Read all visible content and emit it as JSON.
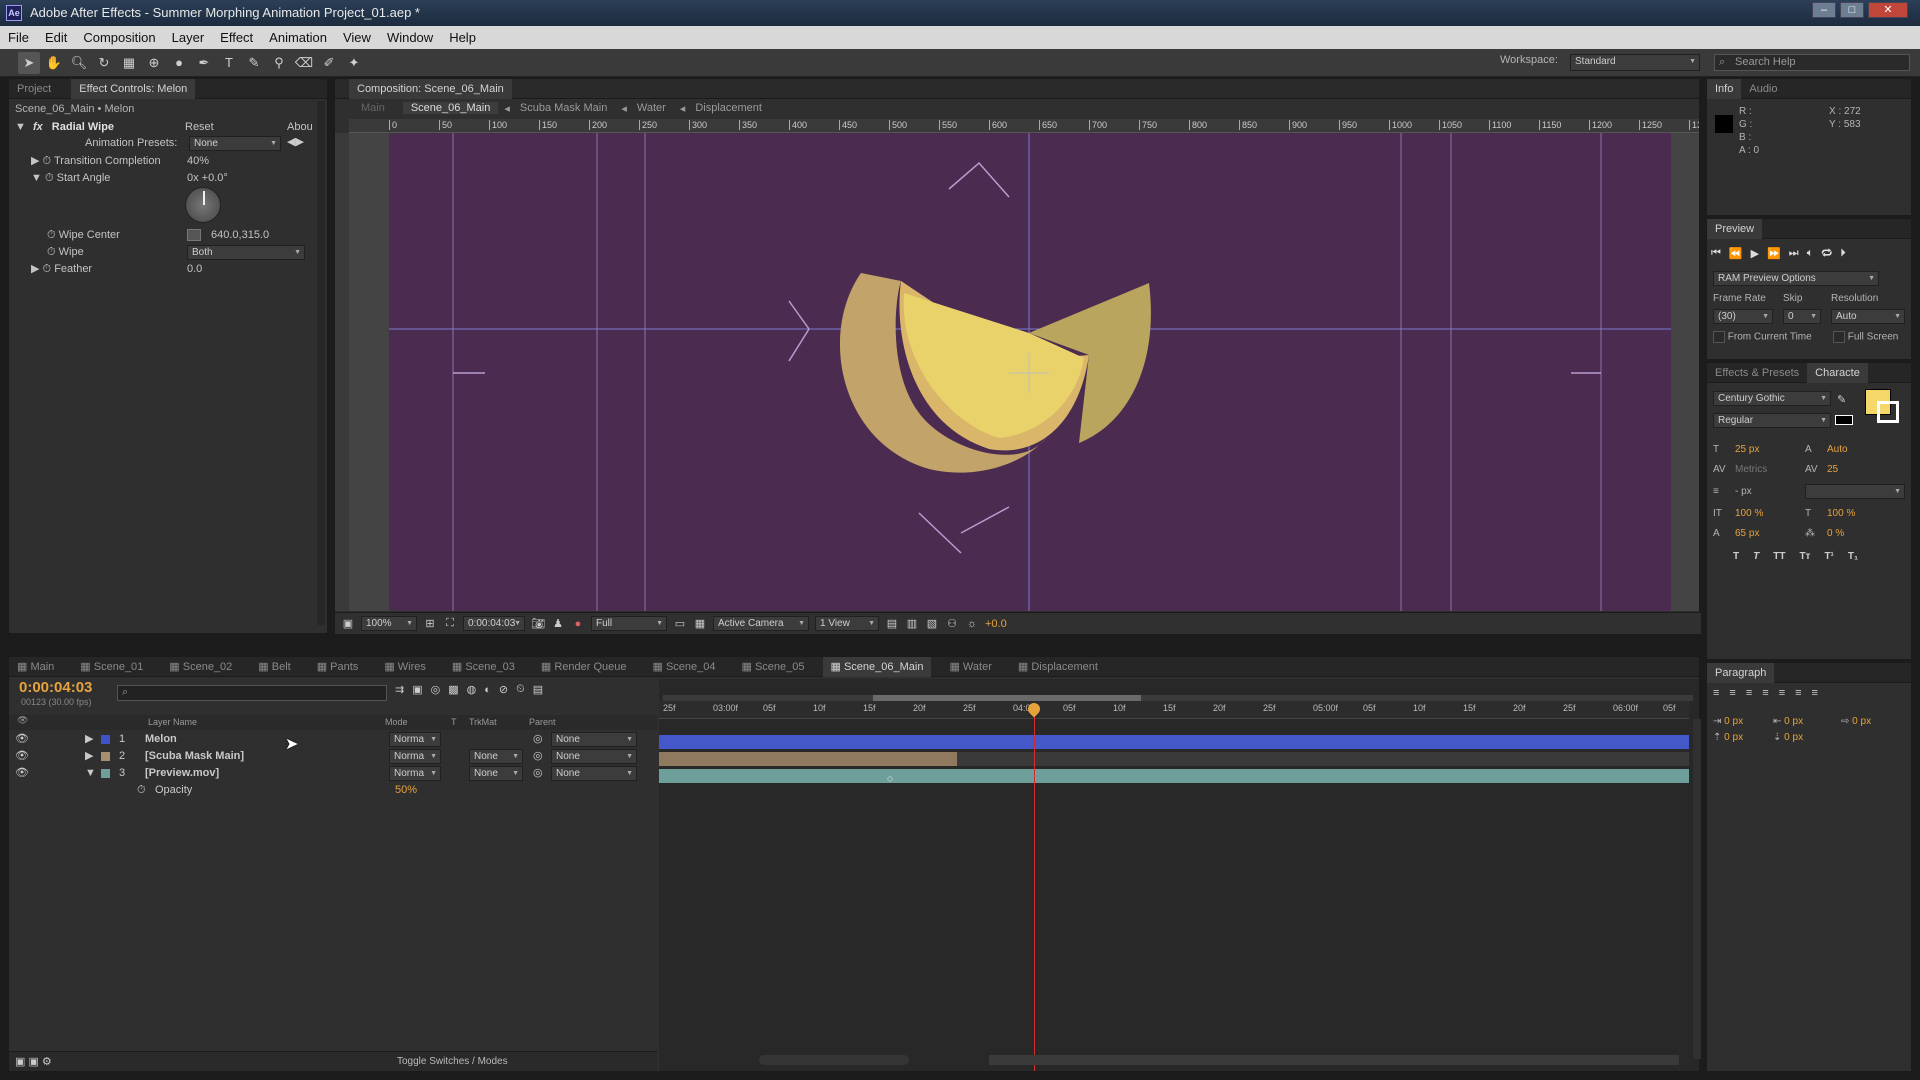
{
  "window": {
    "title": "Adobe After Effects - Summer Morphing Animation Project_01.aep *",
    "app_icon": "Ae"
  },
  "menu": [
    "File",
    "Edit",
    "Composition",
    "Layer",
    "Effect",
    "Animation",
    "View",
    "Window",
    "Help"
  ],
  "toolbar": {
    "workspace_label": "Workspace:",
    "workspace_value": "Standard",
    "search_placeholder": "Search Help"
  },
  "effect_panel": {
    "tabs": [
      "Project",
      "Effect Controls: Melon"
    ],
    "breadcrumb": "Scene_06_Main • Melon",
    "effect_name": "Radial Wipe",
    "reset": "Reset",
    "about": "Abou",
    "presets_label": "Animation Presets:",
    "presets_value": "None",
    "props": [
      {
        "label": "Transition Completion",
        "value": "40%"
      },
      {
        "label": "Start Angle",
        "value": "0x +0.0°"
      },
      {
        "label": "Wipe Center",
        "value": "640.0,315.0"
      },
      {
        "label": "Wipe",
        "value": "Both"
      },
      {
        "label": "Feather",
        "value": "0.0"
      }
    ]
  },
  "comp_panel": {
    "title": "Composition: Scene_06_Main",
    "flow": [
      "Main",
      "Scene_06_Main",
      "Scuba Mask Main",
      "Water",
      "Displacement"
    ],
    "ruler": [
      "0",
      "50",
      "100",
      "150",
      "200",
      "250",
      "300",
      "350",
      "400",
      "450",
      "500",
      "550",
      "600",
      "650",
      "700",
      "750",
      "800",
      "850",
      "900",
      "950",
      "1000",
      "1050",
      "1100",
      "1150",
      "1200",
      "1250",
      "130"
    ],
    "footer": {
      "zoom": "100%",
      "time": "0:00:04:03",
      "resolution": "Full",
      "camera": "Active Camera",
      "view": "1 View",
      "exposure": "+0.0"
    }
  },
  "info_panel": {
    "tabs": [
      "Info",
      "Audio"
    ],
    "r": "R :",
    "g": "G :",
    "b": "B :",
    "a": "A : 0",
    "x": "X : 272",
    "y": "Y : 583"
  },
  "preview_panel": {
    "tab": "Preview",
    "ram": "RAM Preview Options",
    "frame_rate_label": "Frame Rate",
    "skip_label": "Skip",
    "resolution_label": "Resolution",
    "frame_rate": "(30)",
    "skip": "0",
    "resolution": "Auto",
    "from_current": "From Current Time",
    "full_screen": "Full Screen"
  },
  "character_panel": {
    "tabs": [
      "Effects & Presets",
      "Characte"
    ],
    "font": "Century Gothic",
    "style": "Regular",
    "size": "25 px",
    "leading": "Auto",
    "kerning": "Metrics",
    "tracking": "25",
    "stroke": "- px",
    "vscale": "100 %",
    "hscale": "100 %",
    "baseline": "65 px",
    "tsume": "0 %",
    "fill_color": "#f5d76a"
  },
  "paragraph_panel": {
    "tab": "Paragraph",
    "vals": [
      "0 px",
      "0 px",
      "0 px",
      "0 px",
      "0 px"
    ]
  },
  "timeline": {
    "tabs": [
      "Main",
      "Scene_01",
      "Scene_02",
      "Belt",
      "Pants",
      "Wires",
      "Scene_03",
      "Render Queue",
      "Scene_04",
      "Scene_05",
      "Scene_06_Main",
      "Water",
      "Displacement"
    ],
    "active_tab": "Scene_06_Main",
    "timecode": "0:00:04:03",
    "frames": "00123 (30.00 fps)",
    "columns": {
      "name": "Layer Name",
      "mode": "Mode",
      "t": "T",
      "trkmat": "TrkMat",
      "parent": "Parent"
    },
    "layers": [
      {
        "num": "1",
        "name": "Melon",
        "mode": "Norma",
        "trkmat": "",
        "parent": "None",
        "color": "#3f52c7"
      },
      {
        "num": "2",
        "name": "[Scuba Mask Main]",
        "mode": "Norma",
        "trkmat": "None",
        "parent": "None",
        "color": "#a98e6d"
      },
      {
        "num": "3",
        "name": "[Preview.mov]",
        "mode": "Norma",
        "trkmat": "None",
        "parent": "None",
        "color": "#6f9f9a"
      }
    ],
    "opacity_label": "Opacity",
    "opacity_value": "50%",
    "ruler": [
      "25f",
      "03:00f",
      "05f",
      "10f",
      "15f",
      "20f",
      "25f",
      "04:00f",
      "05f",
      "10f",
      "15f",
      "20f",
      "25f",
      "05:00f",
      "05f",
      "10f",
      "15f",
      "20f",
      "25f",
      "06:00f",
      "05f"
    ],
    "toggle": "Toggle Switches / Modes"
  }
}
